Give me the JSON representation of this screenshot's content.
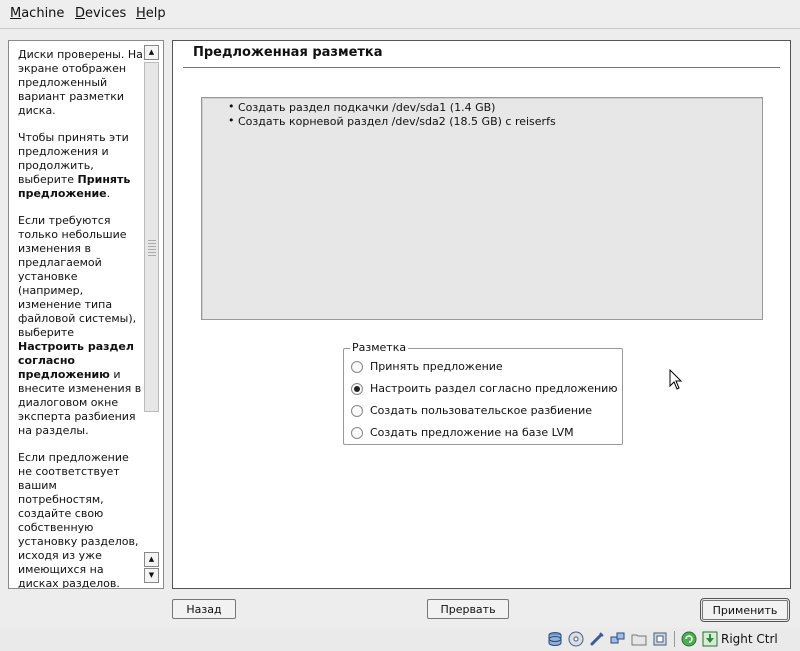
{
  "menubar": {
    "items": [
      {
        "label": "Machine",
        "accel": "M",
        "rest": "achine"
      },
      {
        "label": "Devices",
        "accel": "D",
        "rest": "evices"
      },
      {
        "label": "Help",
        "accel": "H",
        "rest": "elp"
      }
    ]
  },
  "help": {
    "paragraphs": [
      {
        "text": "Диски проверены. На экране отображен предложенный вариант разметки диска."
      },
      {
        "pre": "Чтобы принять эти предложения и продолжить, выберите ",
        "bold": "Принять предложение",
        "post": "."
      },
      {
        "pre": "Если требуются только небольшие изменения в предлагаемой установке (например, изменение типа файловой системы), выберите ",
        "bold": "Настроить раздел согласно предложению",
        "post": " и внесите изменения в диалоговом окне эксперта разбиения на разделы."
      },
      {
        "text": "Если предложение не соответствует вашим потребностям, создайте свою собственную установку разделов, исходя из уже имеющихся на дисках разделов. Для этого выберите"
      }
    ]
  },
  "main": {
    "title": "Предложенная разметка",
    "proposal_items": [
      "Создать раздел подкачки /dev/sda1 (1.4 GB)",
      "Создать корневой раздел /dev/sda2 (18.5 GB) с reiserfs"
    ],
    "partitioning": {
      "legend": "Разметка",
      "options": [
        {
          "label": "Принять предложение",
          "checked": false
        },
        {
          "label": "Настроить раздел согласно предложению",
          "checked": true
        },
        {
          "label": "Создать пользовательское разбиение",
          "checked": false
        },
        {
          "label": "Создать предложение на базе LVM",
          "checked": false
        }
      ]
    }
  },
  "buttons": {
    "back": "Назад",
    "abort": "Прервать",
    "apply": "Применить"
  },
  "statusbar": {
    "host_key": "Right Ctrl",
    "icons": [
      "hard-disk-icon",
      "optical-disc-icon",
      "usb-icon",
      "network-icon",
      "shared-folder-icon",
      "video-capture-icon",
      "mouse-integration-icon",
      "host-key-icon"
    ]
  }
}
